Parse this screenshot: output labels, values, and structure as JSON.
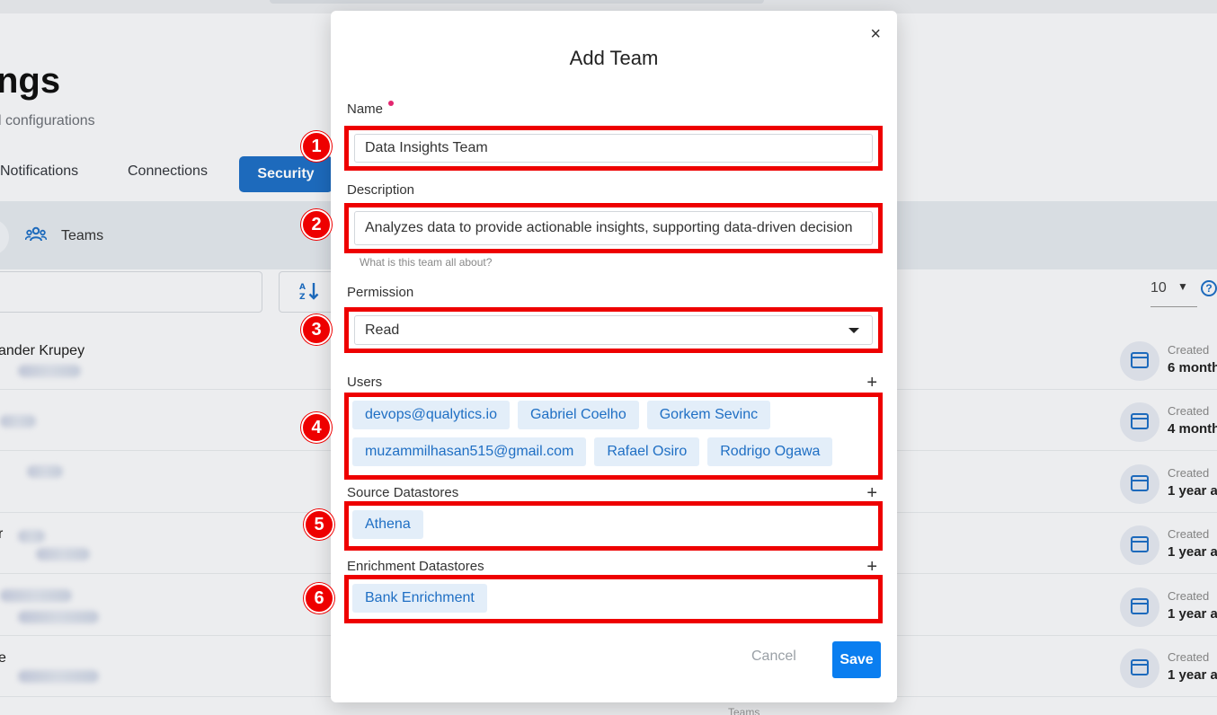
{
  "background": {
    "page_title": "ngs",
    "page_subtitle": "l configurations",
    "tabs": {
      "notifications": "Notifications",
      "connections": "Connections",
      "security": "Security"
    },
    "subnav": {
      "teams": "Teams"
    },
    "per_page": "10",
    "help": "?",
    "rows": [
      {
        "name": "ander Krupey",
        "created_label": "Created",
        "created_value": "6 month"
      },
      {
        "name": "",
        "created_label": "Created",
        "created_value": "4 month"
      },
      {
        "name": "",
        "created_label": "Created",
        "created_value": "1 year ac"
      },
      {
        "name": "r",
        "created_label": "Created",
        "created_value": "1 year ac"
      },
      {
        "name": "",
        "created_label": "Created",
        "created_value": "1 year ac"
      },
      {
        "name": "e",
        "created_label": "Created",
        "created_value": "1 year ac"
      }
    ],
    "footer_hint": "Teams"
  },
  "modal": {
    "title": "Add Team",
    "close": "×",
    "name": {
      "label": "Name",
      "value": "Data Insights Team"
    },
    "description": {
      "label": "Description",
      "value": "Analyzes data to provide actionable insights, supporting data-driven decision",
      "helper": "What is this team all about?"
    },
    "permission": {
      "label": "Permission",
      "value": "Read"
    },
    "users": {
      "label": "Users",
      "items": [
        "devops@qualytics.io",
        "Gabriel Coelho",
        "Gorkem Sevinc",
        "muzammilhasan515@gmail.com",
        "Rafael Osiro",
        "Rodrigo Ogawa"
      ]
    },
    "source_datastores": {
      "label": "Source Datastores",
      "items": [
        "Athena"
      ]
    },
    "enrichment_datastores": {
      "label": "Enrichment Datastores",
      "items": [
        "Bank Enrichment"
      ]
    },
    "cancel_label": "Cancel",
    "save_label": "Save",
    "plus": "+"
  },
  "markers": [
    "1",
    "2",
    "3",
    "4",
    "5",
    "6"
  ],
  "colors": {
    "accent": "#0a7ef0",
    "highlight": "#ee0000",
    "chip_bg": "#e3eef9",
    "chip_text": "#1f6fc4"
  }
}
